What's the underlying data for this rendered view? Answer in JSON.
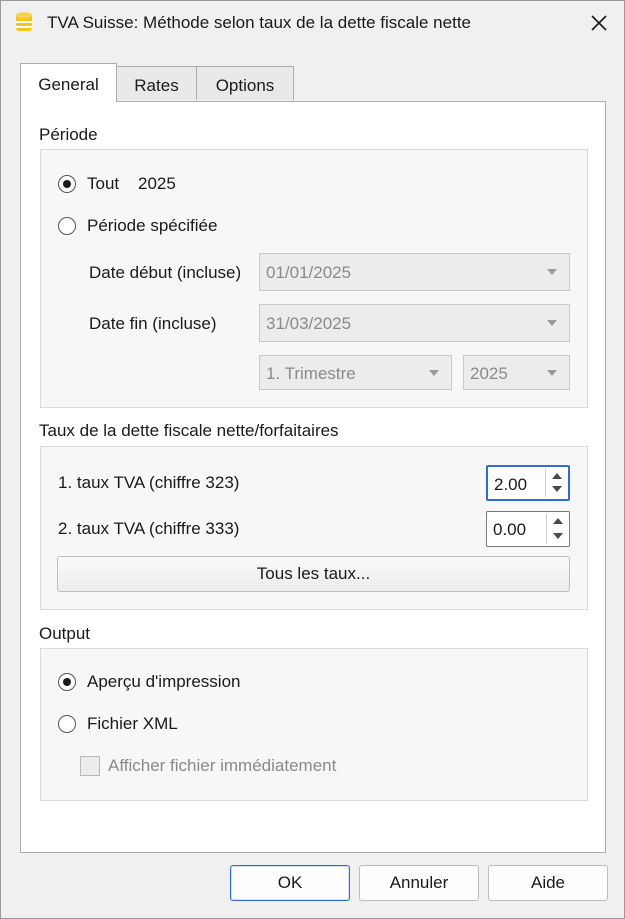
{
  "window": {
    "title": "TVA Suisse: Méthode selon taux de la dette fiscale nette",
    "app_icon": "banana-cylinder-icon",
    "close_icon": "close-icon"
  },
  "tabs": [
    {
      "label": "General",
      "active": true
    },
    {
      "label": "Rates",
      "active": false
    },
    {
      "label": "Options",
      "active": false
    }
  ],
  "periode": {
    "title": "Période",
    "tout_label": "Tout",
    "tout_year": "2025",
    "specified_label": "Période spécifiée",
    "selected": "tout",
    "date_debut_label": "Date début (incluse)",
    "date_debut_value": "01/01/2025",
    "date_fin_label": "Date fin (incluse)",
    "date_fin_value": "31/03/2025",
    "period_select": "1. Trimestre",
    "year_select": "2025"
  },
  "taux": {
    "title": "Taux de la dette fiscale nette/forfaitaires",
    "rate1_label": "1. taux TVA (chiffre 323)",
    "rate1_value": "2.00",
    "rate2_label": "2. taux TVA (chiffre 333)",
    "rate2_value": "0.00",
    "all_rates_button": "Tous les taux..."
  },
  "output": {
    "title": "Output",
    "preview_label": "Aperçu d'impression",
    "xml_label": "Fichier XML",
    "selected": "preview",
    "show_file_label": "Afficher fichier immédiatement",
    "show_file_checked": false
  },
  "footer": {
    "ok": "OK",
    "cancel": "Annuler",
    "help": "Aide"
  },
  "colors": {
    "accent": "#2f6cd8",
    "icon_yellow": "#f5c518"
  }
}
